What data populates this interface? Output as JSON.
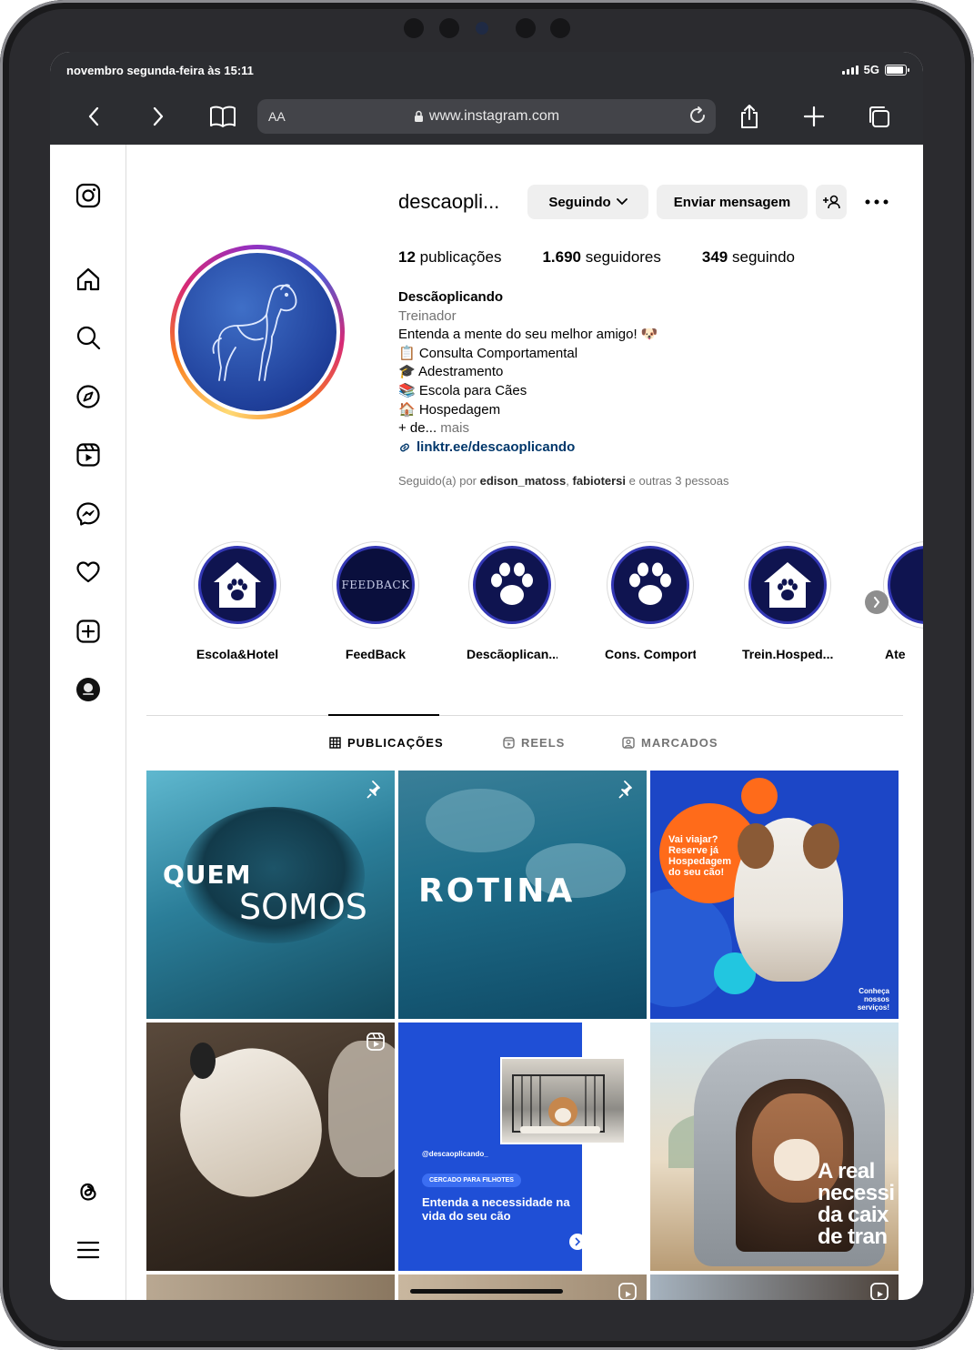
{
  "status": {
    "time": "novembro segunda-feira às 15:11",
    "network": "5G",
    "battery_level": 0.9
  },
  "browser": {
    "aa_label": "AA",
    "url": "www.instagram.com"
  },
  "sidebar": {
    "items": [
      "instagram-logo",
      "home",
      "search",
      "explore",
      "reels",
      "messages",
      "notifications",
      "create",
      "profile",
      "threads",
      "menu"
    ]
  },
  "profile": {
    "username": "descaopli...",
    "following_button": "Seguindo",
    "message_button": "Enviar mensagem",
    "stats": {
      "posts_count": "12",
      "posts_label": "publicações",
      "followers_count": "1.690",
      "followers_label": "seguidores",
      "following_count": "349",
      "following_label": "seguindo"
    },
    "name": "Descãoplicando",
    "category": "Treinador",
    "bio": [
      "Entenda a mente do seu melhor amigo! 🐶",
      "📋 Consulta Comportamental",
      "🎓 Adestramento",
      "📚 Escola para Cães",
      "🏠 Hospedagem"
    ],
    "bio_truncated": "+ de...",
    "bio_more": "mais",
    "link": "linktr.ee/descaoplicando",
    "followed_by_prefix": "Seguido(a) por",
    "followed_by_user1": "edison_matoss",
    "followed_by_user2": "fabiotersi",
    "followed_by_suffix": "e outras 3 pessoas"
  },
  "highlights": [
    {
      "label": "Escola&Hotel",
      "icon": "paw-house-icon"
    },
    {
      "label": "FeedBack",
      "icon": "feedback-text",
      "cover_text": "FEEDBACK"
    },
    {
      "label": "Descãoplican...",
      "icon": "paw-icon"
    },
    {
      "label": "Cons. Comport.",
      "icon": "paw-icon"
    },
    {
      "label": "Trein.Hosped...",
      "icon": "paw-house-icon"
    },
    {
      "label": "Ate",
      "icon": "paw-icon"
    }
  ],
  "tabs": [
    {
      "label": "PUBLICAÇÕES",
      "active": true,
      "icon": "grid-icon"
    },
    {
      "label": "REELS",
      "active": false,
      "icon": "reels-icon"
    },
    {
      "label": "MARCADOS",
      "active": false,
      "icon": "tagged-icon"
    }
  ],
  "posts": [
    {
      "text1": "QUEM",
      "text2": "SOMOS",
      "badge": "pin-icon"
    },
    {
      "text1": "ROTINA",
      "badge": "pin-icon"
    },
    {
      "text1": "Vai viajar? Reserve já Hospedagem do seu cão!",
      "text2": "Conheça nossos serviços!"
    },
    {
      "badge": "reel-icon"
    },
    {
      "handle": "@descaoplicando_",
      "pill": "CERCADO PARA FILHOTES",
      "text1": "Entenda a necessidade na vida do seu cão"
    },
    {
      "text1": "A real necessi da caix de tran"
    }
  ],
  "colors": {
    "accent": "#0095f6",
    "link": "#00376b",
    "chrome": "#2c2d31",
    "highlight_bg": "#0f1450"
  }
}
